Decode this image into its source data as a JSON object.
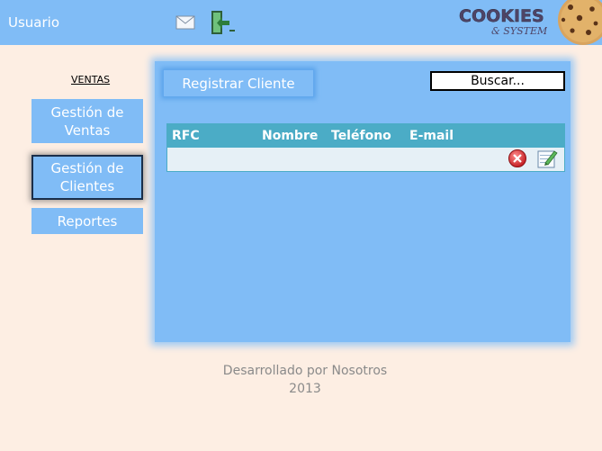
{
  "header": {
    "user_label": "Usuario",
    "icons": [
      "mail-icon",
      "logout-icon"
    ],
    "logo": {
      "line1": "COOKIES",
      "line2": "& SYSTEM"
    }
  },
  "sidebar": {
    "section_title": "VENTAS",
    "items": [
      {
        "label_line1": "Gestión de",
        "label_line2": "Ventas",
        "active": false
      },
      {
        "label_line1": "Gestión de",
        "label_line2": "Clientes",
        "active": true
      },
      {
        "label_line1": "Reportes",
        "label_line2": "",
        "active": false
      }
    ]
  },
  "main": {
    "register_button": "Registrar Cliente",
    "search_placeholder": "Buscar...",
    "table": {
      "columns": [
        "RFC",
        "Nombre",
        "Teléfono",
        "E-mail"
      ],
      "rows": [
        {
          "rfc": "",
          "nombre": "",
          "telefono": "",
          "email": "",
          "actions": [
            "delete-icon",
            "edit-icon"
          ]
        }
      ]
    }
  },
  "footer": {
    "line1": "Desarrollado por Nosotros",
    "line2": "2013"
  },
  "colors": {
    "header_bg": "#80bcf6",
    "page_bg": "#fdeee3",
    "table_header": "#4bacc6",
    "footer_text": "#8a8a8a"
  }
}
